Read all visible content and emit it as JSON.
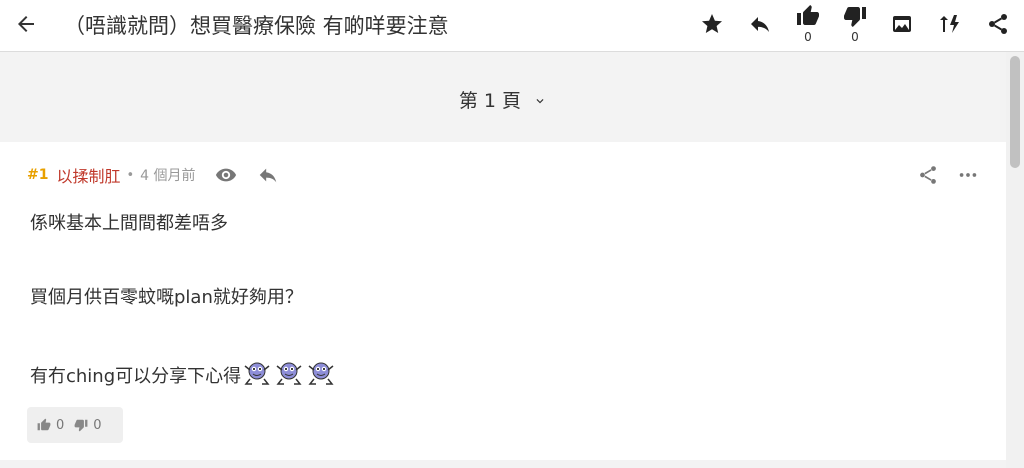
{
  "header": {
    "back_icon": "arrow-left-icon",
    "title": "（唔識就問）想買醫療保險 有啲咩要注意",
    "like_count": "0",
    "dislike_count": "0",
    "icons": [
      "star-icon",
      "reply-icon",
      "thumbs-up-icon",
      "thumbs-down-icon",
      "image-icon",
      "sort-icon",
      "share-icon"
    ]
  },
  "pagination": {
    "label": "第 1 頁",
    "dropdown_icon": "chevron-down-icon"
  },
  "post": {
    "floor": "#1",
    "author": "以揉制肛",
    "separator": "•",
    "time": "4 個月前",
    "lines": [
      "係咪基本上間間都差唔多",
      "買個月供百零蚊嘅plan就好夠用？",
      "有冇ching可以分享下心得"
    ],
    "emoji_count": 3,
    "likes": "0",
    "dislikes": "0"
  },
  "colors": {
    "floor": "#e8a000",
    "author": "#c0392b",
    "meta": "#999999"
  }
}
